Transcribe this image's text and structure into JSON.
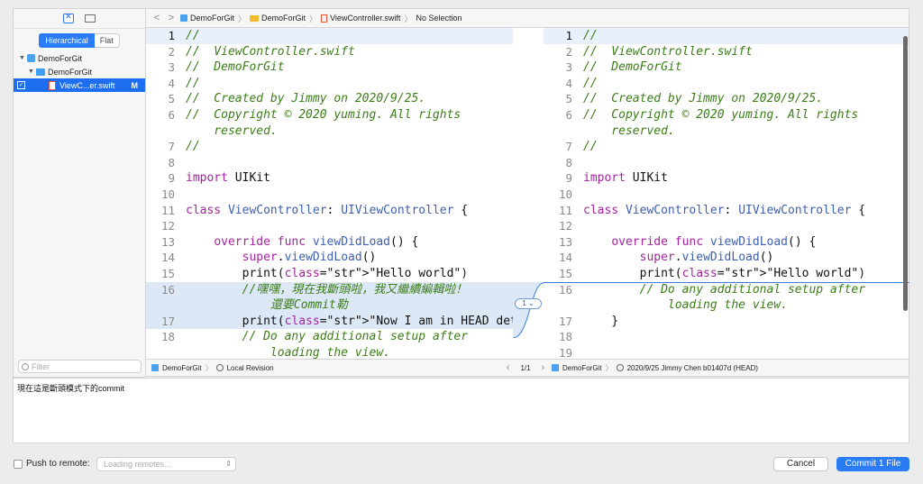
{
  "navigator": {
    "segment_on": "Hierarchical",
    "segment_off": "Flat",
    "tree": [
      {
        "label": "DemoForGit",
        "kind": "project"
      },
      {
        "label": "DemoForGit",
        "kind": "folder"
      },
      {
        "label": "ViewC...er.swift",
        "kind": "file",
        "badge": "M",
        "checked": "✓"
      }
    ],
    "filter_placeholder": "Filter"
  },
  "jumpbar": {
    "back": "<",
    "forward": ">",
    "crumbs": [
      "DemoForGit",
      "DemoForGit",
      "ViewController.swift",
      "No Selection"
    ]
  },
  "left_editor": {
    "lines": [
      {
        "n": "1",
        "t": "//"
      },
      {
        "n": "2",
        "t": "//  ViewController.swift"
      },
      {
        "n": "3",
        "t": "//  DemoForGit"
      },
      {
        "n": "4",
        "t": "//"
      },
      {
        "n": "5",
        "t": "//  Created by Jimmy on 2020/9/25."
      },
      {
        "n": "6",
        "t": "//  Copyright © 2020 yuming. All rights"
      },
      {
        "n": "",
        "t": "    reserved."
      },
      {
        "n": "7",
        "t": "//"
      },
      {
        "n": "8",
        "t": ""
      },
      {
        "n": "9",
        "t": "import UIKit"
      },
      {
        "n": "10",
        "t": ""
      },
      {
        "n": "11",
        "t": "class ViewController: UIViewController {"
      },
      {
        "n": "12",
        "t": ""
      },
      {
        "n": "13",
        "t": "    override func viewDidLoad() {"
      },
      {
        "n": "14",
        "t": "        super.viewDidLoad()"
      },
      {
        "n": "15",
        "t": "        print(\"Hello world\")"
      },
      {
        "n": "16",
        "t": "        //嘿嘿，現在我斷頭啦，我又繼續編輯啦！"
      },
      {
        "n": "",
        "t": "            還要Commit勒"
      },
      {
        "n": "17",
        "t": "        print(\"Now I am in HEAD detached\")"
      },
      {
        "n": "18",
        "t": "        // Do any additional setup after"
      },
      {
        "n": "",
        "t": "            loading the view."
      }
    ]
  },
  "right_editor": {
    "lines": [
      {
        "n": "1",
        "t": "//"
      },
      {
        "n": "2",
        "t": "//  ViewController.swift"
      },
      {
        "n": "3",
        "t": "//  DemoForGit"
      },
      {
        "n": "4",
        "t": "//"
      },
      {
        "n": "5",
        "t": "//  Created by Jimmy on 2020/9/25."
      },
      {
        "n": "6",
        "t": "//  Copyright © 2020 yuming. All rights"
      },
      {
        "n": "",
        "t": "    reserved."
      },
      {
        "n": "7",
        "t": "//"
      },
      {
        "n": "8",
        "t": ""
      },
      {
        "n": "9",
        "t": "import UIKit"
      },
      {
        "n": "10",
        "t": ""
      },
      {
        "n": "11",
        "t": "class ViewController: UIViewController {"
      },
      {
        "n": "12",
        "t": ""
      },
      {
        "n": "13",
        "t": "    override func viewDidLoad() {"
      },
      {
        "n": "14",
        "t": "        super.viewDidLoad()"
      },
      {
        "n": "15",
        "t": "        print(\"Hello world\")"
      },
      {
        "n": "16",
        "t": "        // Do any additional setup after"
      },
      {
        "n": "",
        "t": "            loading the view."
      },
      {
        "n": "17",
        "t": "    }"
      },
      {
        "n": "18",
        "t": ""
      },
      {
        "n": "19",
        "t": ""
      }
    ]
  },
  "diff": {
    "count_label": "1 ⌄"
  },
  "pathbar": {
    "left_project": "DemoForGit",
    "left_revision": "Local Revision",
    "counter": "1/1",
    "right_project": "DemoForGit",
    "right_revision": "2020/9/25  Jimmy Chen  b01407d (HEAD)"
  },
  "commit_message": "現在這是斷頭模式下的commit",
  "footer": {
    "push_label": "Push to remote:",
    "remote_placeholder": "Loading remotes...",
    "cancel_label": "Cancel",
    "commit_label": "Commit 1 File"
  },
  "colors": {
    "accent": "#2a7bf6",
    "comment": "#3b7d17",
    "keyword": "#a4249f",
    "string": "#c0242b",
    "type": "#3e5fb0",
    "change_bg": "#dde8f7"
  }
}
